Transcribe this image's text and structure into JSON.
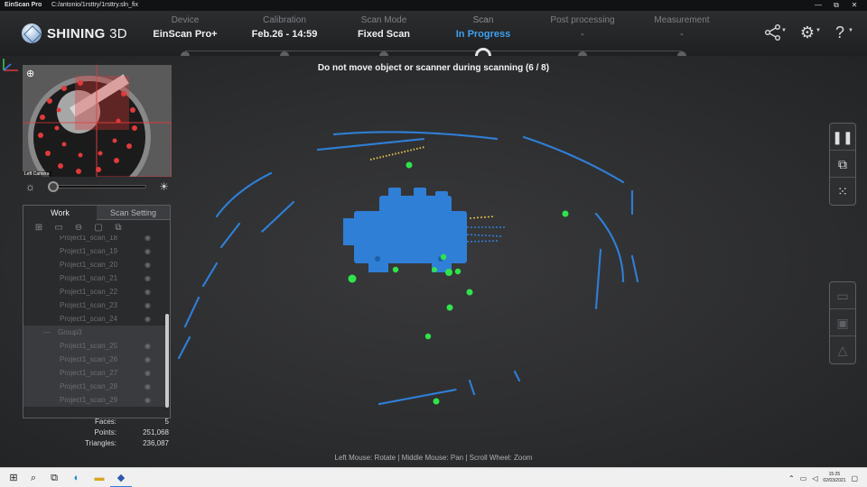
{
  "window": {
    "app_name": "EinScan Pro",
    "file_path": "C:/antonio/1rsttry/1rsttry.sln_fix",
    "controls": [
      "—",
      "⧉",
      "✕"
    ]
  },
  "header": {
    "logo_text": "SHINING",
    "logo_suffix": "3D",
    "steps": [
      {
        "label": "Device",
        "value": "EinScan Pro+"
      },
      {
        "label": "Calibration",
        "value": "Feb.26 - 14:59"
      },
      {
        "label": "Scan Mode",
        "value": "Fixed Scan"
      },
      {
        "label": "Scan",
        "value": "In Progress"
      },
      {
        "label": "Post processing",
        "value": "-"
      },
      {
        "label": "Measurement",
        "value": "-"
      }
    ],
    "active_step": "Scan",
    "icons": [
      "share-icon",
      "gear-icon",
      "help-icon"
    ]
  },
  "viewport": {
    "scan_message": "Do not move object or scanner during scanning (6 / 8)",
    "help_text": "Left Mouse: Rotate | Middle Mouse: Pan | Scroll Wheel: Zoom"
  },
  "camera": {
    "label": "Left Camera",
    "brightness": 0.0
  },
  "panel": {
    "tabs": [
      "Work",
      "Scan Setting"
    ],
    "active_tab": "Work",
    "tool_icons": [
      "add-icon",
      "open-folder-icon",
      "remove-icon",
      "folder-icon",
      "merge-icon"
    ],
    "rows": [
      {
        "name": "Project1_scan_18",
        "type": "scan"
      },
      {
        "name": "Project1_scan_19",
        "type": "scan"
      },
      {
        "name": "Project1_scan_20",
        "type": "scan"
      },
      {
        "name": "Project1_scan_21",
        "type": "scan"
      },
      {
        "name": "Project1_scan_22",
        "type": "scan"
      },
      {
        "name": "Project1_scan_23",
        "type": "scan"
      },
      {
        "name": "Project1_scan_24",
        "type": "scan"
      },
      {
        "name": "Group3",
        "type": "group"
      },
      {
        "name": "Project1_scan_25",
        "type": "sub"
      },
      {
        "name": "Project1_scan_26",
        "type": "sub"
      },
      {
        "name": "Project1_scan_27",
        "type": "sub"
      },
      {
        "name": "Project1_scan_28",
        "type": "sub"
      },
      {
        "name": "Project1_scan_29",
        "type": "sub"
      }
    ]
  },
  "stats": {
    "faces_label": "Faces:",
    "faces": "5",
    "points_label": "Points:",
    "points": "251,068",
    "triangles_label": "Triangles:",
    "triangles": "236,087"
  },
  "right_toolbar": {
    "top": [
      "pause-icon",
      "capture-icon",
      "point-cloud-icon"
    ],
    "bottom": [
      "open-folder-icon",
      "save-icon",
      "mesh-icon"
    ]
  },
  "taskbar": {
    "time": "15:25",
    "date": "02/03/2021"
  },
  "colors": {
    "accent": "#3fa0ee",
    "point_cloud": "#2f7fd6",
    "marker": "#2ee44a",
    "highlight": "#e0c04a"
  }
}
